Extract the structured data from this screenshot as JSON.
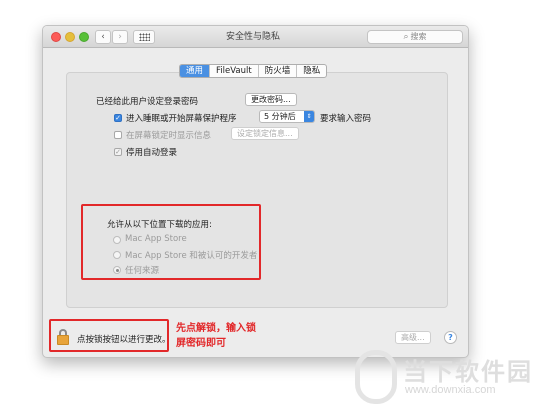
{
  "window": {
    "title": "安全性与隐私",
    "search_placeholder": "搜索",
    "nav_back": "‹",
    "nav_forward": "›"
  },
  "tabs": [
    {
      "label": "通用",
      "active": true
    },
    {
      "label": "FileVault",
      "active": false
    },
    {
      "label": "防火墙",
      "active": false
    },
    {
      "label": "隐私",
      "active": false
    }
  ],
  "general": {
    "password_set_label": "已经给此用户设定登录密码",
    "change_password_button": "更改密码...",
    "require_password": {
      "checkbox_label": "进入睡眠或开始屏幕保护程序",
      "checked": true,
      "select_value": "5 分钟后",
      "suffix": "要求输入密码"
    },
    "show_message": {
      "checkbox_label": "在屏幕锁定时显示信息",
      "checked": false,
      "button": "设定锁定信息..."
    },
    "disable_auto_login": {
      "checkbox_label": "停用自动登录",
      "checked": true
    }
  },
  "downloads": {
    "heading": "允许从以下位置下载的应用:",
    "options": [
      {
        "label": "Mac App Store",
        "selected": false
      },
      {
        "label": "Mac App Store 和被认可的开发者",
        "selected": false
      },
      {
        "label": "任何来源",
        "selected": true
      }
    ]
  },
  "footer": {
    "lock_text": "点按锁按钮以进行更改。",
    "advanced_button": "高级...",
    "help_button": "?"
  },
  "annotation": {
    "line1": "先点解锁，输入锁",
    "line2": "屏密码即可"
  },
  "watermark": {
    "text1": "当下软件园",
    "text2": "www.downxia.com"
  },
  "colors": {
    "accent": "#3b86e0",
    "annotation_red": "#e2282a",
    "lock_orange": "#e8a43a"
  }
}
